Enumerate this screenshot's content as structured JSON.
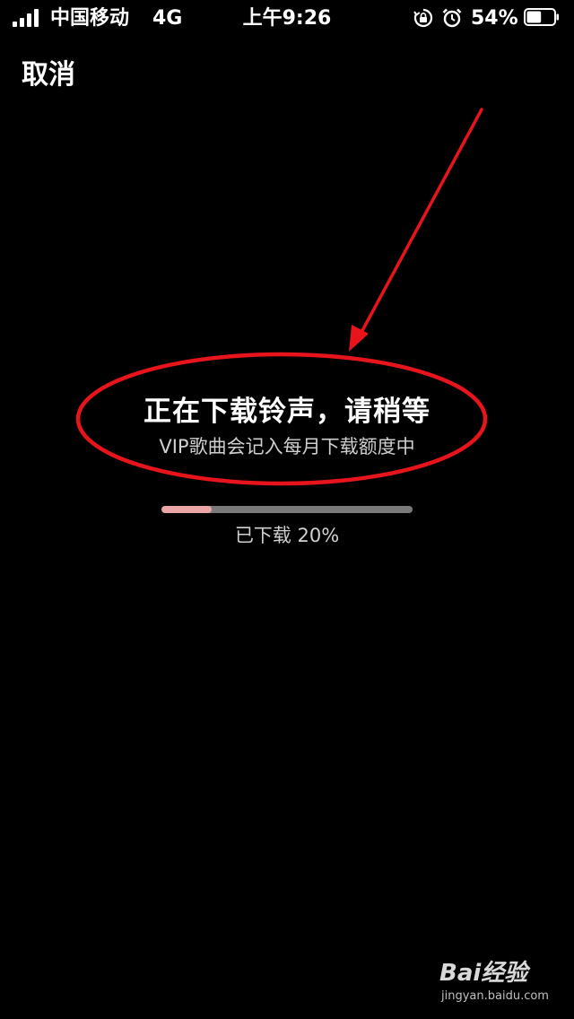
{
  "status_bar": {
    "carrier": "中国移动",
    "network": "4G",
    "time": "上午9:26",
    "battery_percent": "54%",
    "battery_level": 0.54,
    "icons": [
      "signal-icon",
      "orientation-lock-icon",
      "alarm-icon",
      "battery-icon"
    ]
  },
  "header": {
    "cancel_label": "取消"
  },
  "download": {
    "title": "正在下载铃声，请稍等",
    "subtitle": "VIP歌曲会记入每月下载额度中",
    "progress_label": "已下载 20%",
    "progress_value": 0.2
  },
  "watermark": {
    "brand": "Bai经验",
    "url": "jingyan.baidu.com"
  },
  "colors": {
    "background": "#000000",
    "text": "#ffffff",
    "annotation": "#e8141b",
    "progress_fill": "#e9a6a4",
    "progress_track": "#7a7a7a"
  }
}
